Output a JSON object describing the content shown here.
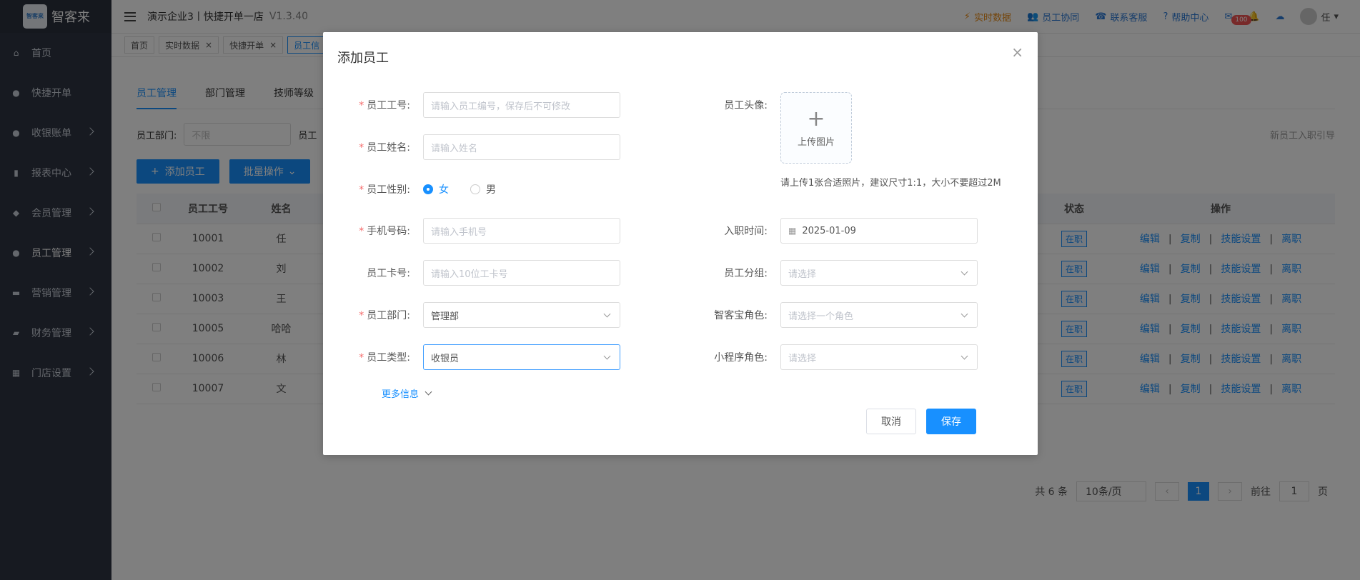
{
  "app": {
    "name": "智客来",
    "logo_text": "智客来",
    "title": "演示企业3丨快捷开单一店",
    "version": "V1.3.40"
  },
  "sidebar": {
    "items": [
      {
        "label": "首页",
        "icon": "home-icon"
      },
      {
        "label": "快捷开单",
        "icon": "bag-icon"
      },
      {
        "label": "收银账单",
        "icon": "wallet-icon"
      },
      {
        "label": "报表中心",
        "icon": "chart-icon"
      },
      {
        "label": "会员管理",
        "icon": "diamond-icon"
      },
      {
        "label": "员工管理",
        "icon": "user-icon"
      },
      {
        "label": "营销管理",
        "icon": "briefcase-icon"
      },
      {
        "label": "财务管理",
        "icon": "finance-icon"
      },
      {
        "label": "门店设置",
        "icon": "grid-icon"
      }
    ]
  },
  "topbar": {
    "realtime": "实时数据",
    "staff_collab": "员工协同",
    "contact": "联系客服",
    "help": "帮助中心",
    "msg_badge": "100",
    "user": "任"
  },
  "tabs": [
    "首页",
    "实时数据",
    "快捷开单",
    "员工信"
  ],
  "page": {
    "sub_tabs": [
      "员工管理",
      "部门管理",
      "技师等级"
    ],
    "filter_dept_label": "员工部门:",
    "filter_dept_value": "不限",
    "filter_other_label": "员工",
    "onboard_link": "新员工入职引导",
    "add_btn": "添加员工",
    "batch_btn": "批量操作"
  },
  "table": {
    "headers": [
      "员工工号",
      "姓名",
      "状态",
      "操作"
    ],
    "rows": [
      {
        "id": "10001",
        "name": "任",
        "status": "在职"
      },
      {
        "id": "10002",
        "name": "刘",
        "status": "在职"
      },
      {
        "id": "10003",
        "name": "王",
        "status": "在职"
      },
      {
        "id": "10005",
        "name": "哈哈",
        "status": "在职"
      },
      {
        "id": "10006",
        "name": "林",
        "status": "在职"
      },
      {
        "id": "10007",
        "name": "文",
        "status": "在职"
      }
    ],
    "ops": [
      "编辑",
      "复制",
      "技能设置",
      "离职"
    ]
  },
  "pager": {
    "total": "共 6 条",
    "size": "10条/页",
    "current": "1",
    "goto_label": "前往",
    "goto_value": "1",
    "page_unit": "页"
  },
  "dialog": {
    "title": "添加员工",
    "fields": {
      "emp_no": {
        "label": "员工工号:",
        "placeholder": "请输入员工编号，保存后不可修改"
      },
      "name": {
        "label": "员工姓名:",
        "placeholder": "请输入姓名"
      },
      "gender": {
        "label": "员工性别:",
        "female": "女",
        "male": "男"
      },
      "phone": {
        "label": "手机号码:",
        "placeholder": "请输入手机号"
      },
      "card": {
        "label": "员工卡号:",
        "placeholder": "请输入10位工卡号"
      },
      "dept": {
        "label": "员工部门:",
        "value": "管理部"
      },
      "type": {
        "label": "员工类型:",
        "value": "收银员"
      },
      "avatar": {
        "label": "员工头像:",
        "upload": "上传图片",
        "hint": "请上传1张合适照片，建议尺寸1:1，大小不要超过2M"
      },
      "join_date": {
        "label": "入职时间:",
        "value": "2025-01-09"
      },
      "group": {
        "label": "员工分组:",
        "placeholder": "请选择"
      },
      "zkb_role": {
        "label": "智客宝角色:",
        "placeholder": "请选择一个角色"
      },
      "mini_role": {
        "label": "小程序角色:",
        "placeholder": "请选择"
      }
    },
    "more": "更多信息",
    "cancel": "取消",
    "save": "保存"
  }
}
